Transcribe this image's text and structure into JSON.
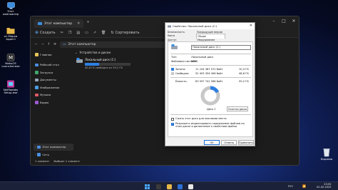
{
  "desktop": {
    "icons": [
      {
        "label": "Этот компьютер"
      },
      {
        "label": "от Маркa Адаптi"
      },
      {
        "label": "MakuOS Launcher.exe"
      },
      {
        "label": "NetTweaks Setup.exe"
      }
    ],
    "recycle_label": "Корзина"
  },
  "explorer": {
    "tab_label": "Этот компьютер",
    "toolbar": {
      "create": "Создать",
      "sort": "Сортировать",
      "more": "···"
    },
    "address": "Этот компьютер",
    "nav": [
      {
        "label": "Главная",
        "color": "#e6c65a"
      },
      {
        "label": "Рабочий стол",
        "color": "#4a8fe0"
      },
      {
        "label": "Загрузки",
        "color": "#3fa66a"
      },
      {
        "label": "Документы",
        "color": "#9aa5b8"
      },
      {
        "label": "Изображения",
        "color": "#4d9de0"
      },
      {
        "label": "Музыка",
        "color": "#e05a6a"
      },
      {
        "label": "Видео",
        "color": "#9b59d0"
      }
    ],
    "nav_bottom": [
      {
        "label": "Этот компьютер",
        "color": "#4a8fe0"
      },
      {
        "label": "Сеть",
        "color": "#4a8fe0"
      }
    ],
    "section_title": "Устройства и диски",
    "drive": {
      "name": "Локальный диск (C:)",
      "free_text": "40,8 ГБ свободно из 59,2 ГБ",
      "used_fraction": 0.31
    },
    "status": {
      "count": "1 элемент",
      "selected": "Выбран 1 элемент"
    }
  },
  "properties": {
    "title": "Свойства: Локальный диск (C:)",
    "tabs": [
      "Безопасность",
      "Предыдущие версии",
      "Квота",
      "Общие",
      "Доступ",
      "Оборудование"
    ],
    "active_tab": "Общие",
    "drive_label": "Локальный диск (С:)",
    "type_label": "Тип:",
    "type_value": "Локальный диск",
    "fs_label": "Файловая система:",
    "fs_value": "NTFS",
    "used_label": "Занято:",
    "used_bytes": "11 104 387 072 байт",
    "used_gb": "10,3 ГБ",
    "free_label": "Свободно:",
    "free_bytes": "52 493 354 496 байт",
    "free_gb": "48,8 ГБ",
    "capacity_label": "Ёмкость:",
    "capacity_bytes": "63 597 741 568 байт",
    "capacity_gb": "59,2 ГБ",
    "used_fraction": 0.175,
    "disk_name": "Диск C",
    "cleanup_label": "Очистка диска",
    "compress_label": "Сжать этот диск для экономии места",
    "index_label": "Разрешить индексировать содержимое файлов на этом диске в дополнение к свойствам файла",
    "buttons": {
      "ok": "ОК",
      "cancel": "Отмена",
      "apply": "Применить"
    },
    "colors": {
      "used": "#2f7fe0",
      "free": "#c8c8c8"
    }
  },
  "taskbar": {
    "time": "23:55",
    "date": "02.02.2025",
    "lang": "РУС"
  }
}
